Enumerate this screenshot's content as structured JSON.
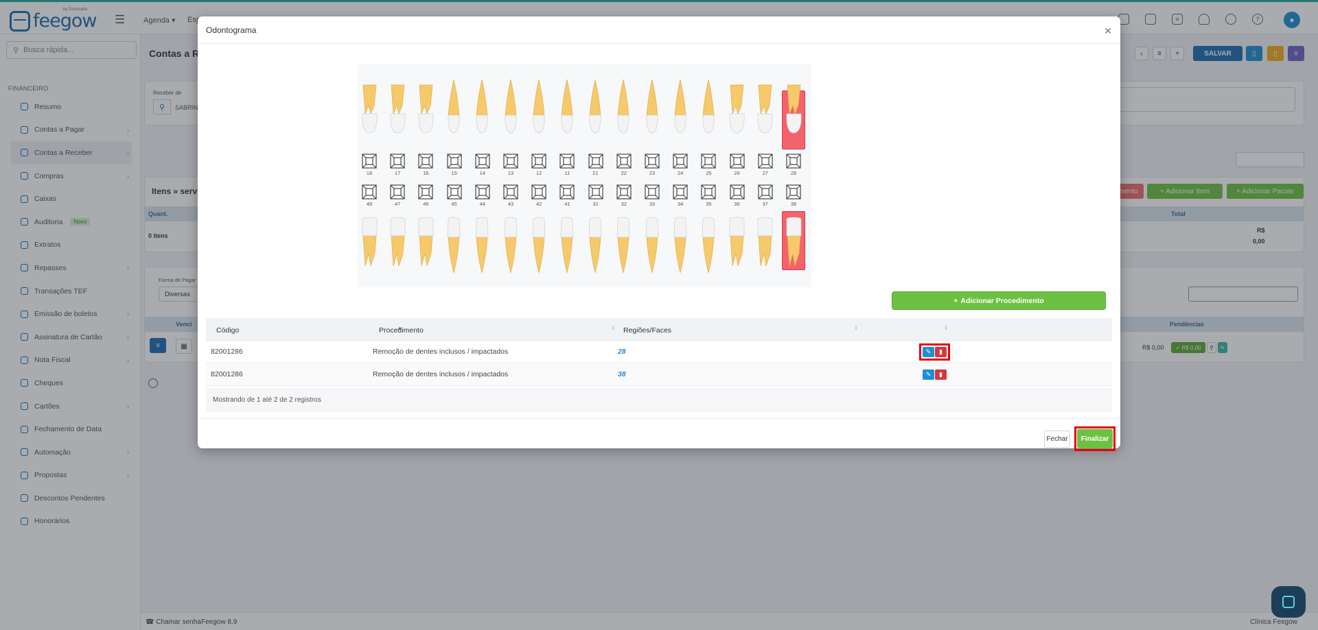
{
  "app": {
    "brand": "feegow",
    "brand_tagline": "by Doctoralia"
  },
  "topnav": {
    "agenda": "Agenda",
    "partial": "Esp"
  },
  "search": {
    "placeholder": "Busca rápida..."
  },
  "sidebar": {
    "section": "FINANCEIRO",
    "items": [
      {
        "label": "Resumo",
        "icon": "chart-icon"
      },
      {
        "label": "Contas a Pagar",
        "icon": "minus-circle-icon",
        "arrow": true
      },
      {
        "label": "Contas a Receber",
        "icon": "plus-circle-icon",
        "arrow": true,
        "active": true
      },
      {
        "label": "Compras",
        "icon": "cart-icon",
        "arrow": true
      },
      {
        "label": "Caixas",
        "icon": "box-icon"
      },
      {
        "label": "Auditoria",
        "icon": "history-icon",
        "badge": "Novo"
      },
      {
        "label": "Extratos",
        "icon": "list-icon"
      },
      {
        "label": "Repasses",
        "icon": "share-icon",
        "arrow": true
      },
      {
        "label": "Transações TEF",
        "icon": "card-icon"
      },
      {
        "label": "Emissão de boletos",
        "icon": "barcode-icon",
        "arrow": true
      },
      {
        "label": "Assinatura de Cartão",
        "icon": "card-icon",
        "arrow": true
      },
      {
        "label": "Nota Fiscal",
        "icon": "doc-icon",
        "arrow": true
      },
      {
        "label": "Cheques",
        "icon": "doc-icon"
      },
      {
        "label": "Cartões",
        "icon": "card-icon",
        "arrow": true
      },
      {
        "label": "Fechamento de Data",
        "icon": "lock-icon"
      },
      {
        "label": "Automação",
        "icon": "gear-icon",
        "arrow": true
      },
      {
        "label": "Propostas",
        "icon": "doc-icon",
        "arrow": true
      },
      {
        "label": "Descontos Pendentes",
        "icon": "doc-icon"
      },
      {
        "label": "Honorários",
        "icon": "calendar-icon"
      }
    ]
  },
  "page": {
    "title_partial": "Contas a Re",
    "receber_de": "Receber de",
    "patient_partial": "SABRIN",
    "items_title_partial": "Itens » servi",
    "quant_header": "Quant.",
    "total_header": "Total",
    "items_count": "0 itens",
    "total_currency": "R$",
    "total_value": "0,00",
    "forma_label": "Forma de Pagar",
    "forma_value": "Diversas",
    "venc_header": "Venci",
    "pend_header": "Pendências",
    "value_row": "R$ 0,00",
    "value_badge": "✓ R$ 0,00",
    "btn_salvar": "SALVAR",
    "btn_add_item": "+ Adicionar Item",
    "btn_add_pacote": "+ Adicionar Pacote",
    "btn_partial": "amento"
  },
  "footer": {
    "chamar": "Chamar senha",
    "version": "Feegow 8.9",
    "clinic": "Clínica Feegow"
  },
  "modal": {
    "title": "Odontograma",
    "upper_numbers": [
      "18",
      "17",
      "16",
      "15",
      "14",
      "13",
      "12",
      "11",
      "21",
      "22",
      "23",
      "24",
      "25",
      "26",
      "27",
      "28"
    ],
    "lower_numbers": [
      "48",
      "47",
      "46",
      "45",
      "44",
      "43",
      "42",
      "41",
      "31",
      "32",
      "33",
      "34",
      "35",
      "36",
      "37",
      "38"
    ],
    "highlighted": [
      "28",
      "38"
    ],
    "add_button": "Adicionar Procedimento",
    "columns": {
      "codigo": "Código",
      "procedimento": "Procedimento",
      "regioes": "Regiões/Faces"
    },
    "rows": [
      {
        "codigo": "82001286",
        "procedimento": "Remoção de dentes inclusos / impactados",
        "regiao": "28"
      },
      {
        "codigo": "82001286",
        "procedimento": "Remoção de dentes inclusos / impactados",
        "regiao": "38"
      }
    ],
    "showing": "Mostrando de 1 até 2 de 2 registros",
    "btn_fechar": "Fechar",
    "btn_finalizar": "Finalizar"
  },
  "colors": {
    "accent": "#1d6db3",
    "green": "#6dc142",
    "danger": "#d9353e",
    "highlight": "#f4636b"
  }
}
